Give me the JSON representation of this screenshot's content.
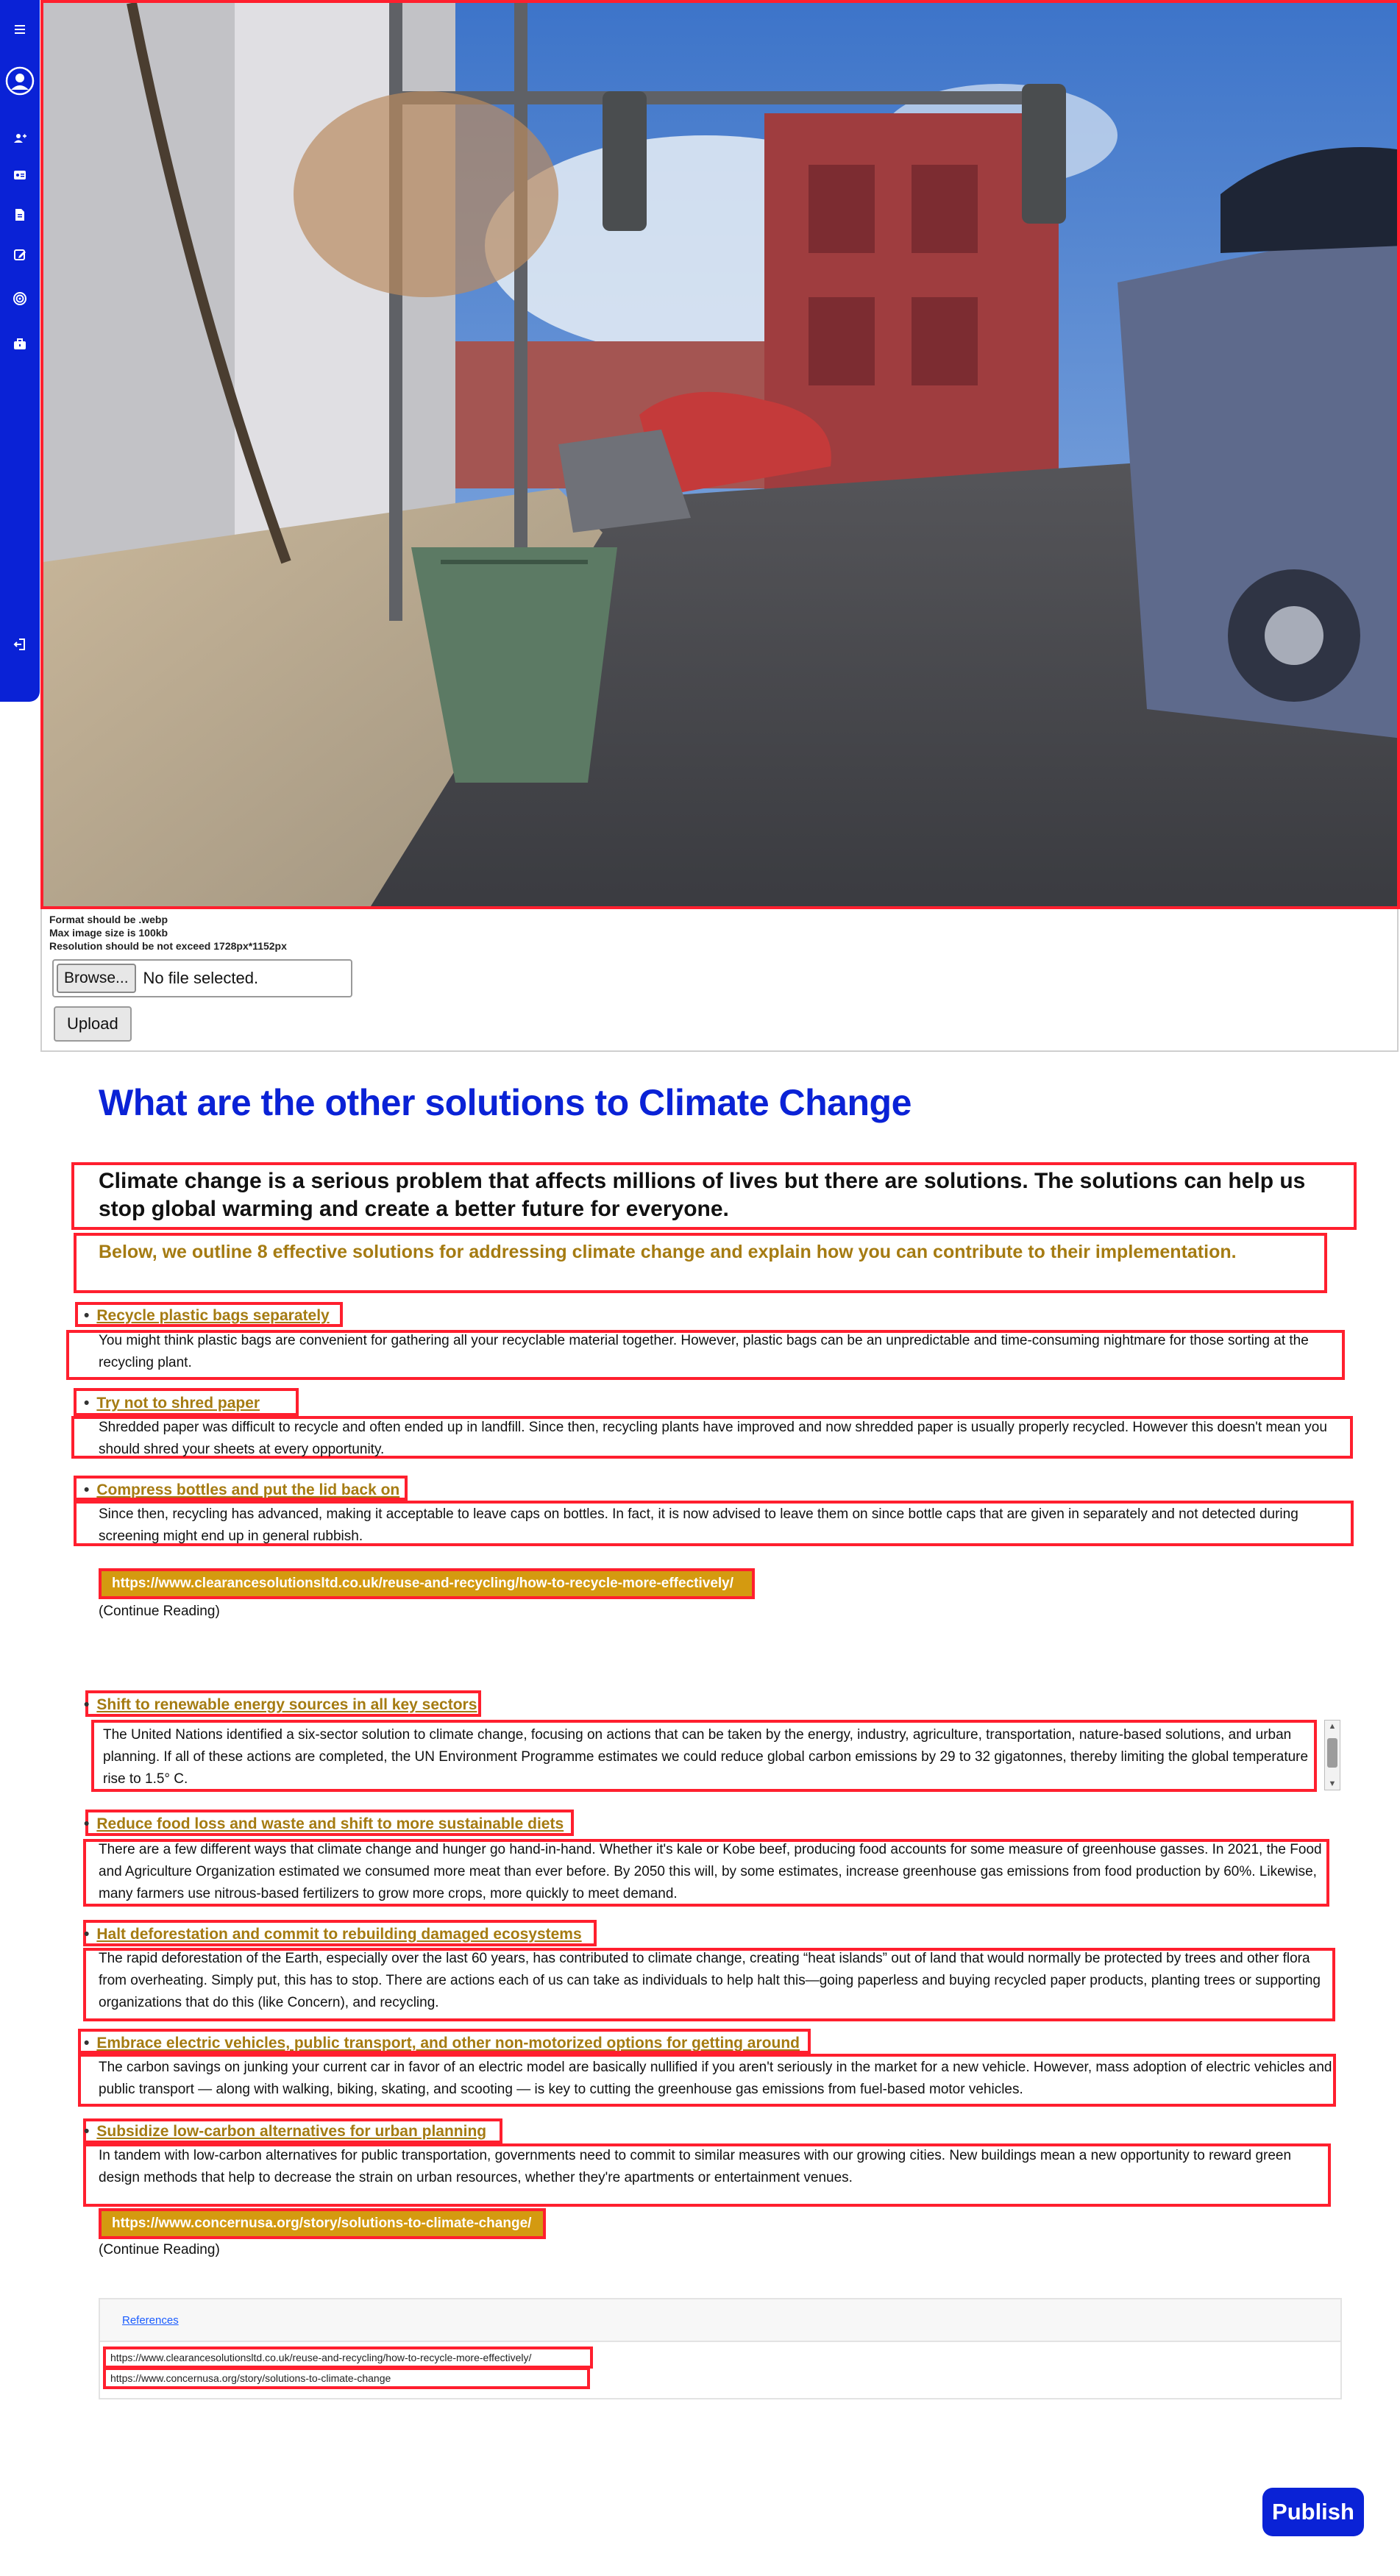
{
  "sidebar": {
    "items": [
      {
        "icon": "menu-icon"
      },
      {
        "icon": "user-avatar-icon"
      },
      {
        "icon": "add-user-icon"
      },
      {
        "icon": "id-card-icon"
      },
      {
        "icon": "document-icon"
      },
      {
        "icon": "edit-icon"
      },
      {
        "icon": "target-icon"
      },
      {
        "icon": "briefcase-icon"
      },
      {
        "icon": "logout-icon"
      }
    ],
    "color": "#0a22d6"
  },
  "upload": {
    "notes": [
      "Format should be .webp",
      "Max image size is 100kb",
      "Resolution should be not exceed 1728px*1152px"
    ],
    "browse_label": "Browse...",
    "file_status": "No file selected.",
    "upload_label": "Upload"
  },
  "article": {
    "title": "What are the other solutions to Climate Change",
    "intro": "Climate change is a serious problem that affects millions of lives but there are solutions. The solutions can help us stop global warming and create a better future for everyone.",
    "sub_intro": "Below, we outline 8 effective solutions for addressing climate change and explain how you can contribute to their implementation.",
    "sections": [
      {
        "heading": "Recycle plastic bags separately",
        "text": "You might think plastic bags are convenient for gathering all your recyclable material together. However, plastic bags can be an unpredictable and time-consuming nightmare for those sorting at the recycling plant."
      },
      {
        "heading": "Try not to shred paper",
        "text": "Shredded paper was difficult to recycle and often ended up in landfill. Since then, recycling plants have improved and now shredded paper is usually properly recycled. However this doesn't mean you should shred your sheets at every opportunity."
      },
      {
        "heading": "Compress bottles and put the lid back on",
        "text": "Since then, recycling has advanced, making it acceptable to leave caps on bottles. In fact, it is now advised to leave them on since bottle caps that are given in separately and not detected during screening might end up in general rubbish."
      },
      {
        "heading": "Shift to renewable energy sources in all key sectors",
        "text": "The United Nations identified a six-sector solution to climate change, focusing on actions that can be taken by the energy, industry, agriculture, transportation, nature-based solutions, and urban planning. If all of these actions are completed, the UN Environment Programme estimates we could reduce global carbon emissions by 29 to 32 gigatonnes, thereby limiting the global temperature rise to 1.5° C."
      },
      {
        "heading": "Reduce food loss and waste and shift to more sustainable diets",
        "text": "There are a few different ways that climate change and hunger go hand-in-hand. Whether it's kale or Kobe beef, producing food accounts for some measure of greenhouse gasses. In 2021, the Food and Agriculture Organization estimated we consumed more meat than ever before. By 2050 this will, by some estimates, increase greenhouse gas emissions from food production by 60%. Likewise, many farmers use nitrous-based fertilizers to grow more crops, more quickly to meet demand."
      },
      {
        "heading": "Halt deforestation and commit to rebuilding damaged ecosystems",
        "text": "The rapid deforestation of the Earth, especially over the last 60 years, has contributed to climate change, creating “heat islands” out of land that would normally be protected by trees and other flora from overheating. Simply put, this has to stop. There are actions each of us can take as individuals to help halt this—going paperless and buying recycled paper products, planting trees or supporting organizations that do this (like Concern), and recycling."
      },
      {
        "heading": "Embrace electric vehicles, public transport, and other non-motorized options for getting around",
        "text": "The carbon savings on junking your current car in favor of an electric model are basically nullified if you aren't seriously in the market for a new vehicle. However, mass adoption of electric vehicles and public transport — along with walking, biking, skating, and scooting — is key to cutting the greenhouse gas emissions from fuel-based motor vehicles."
      },
      {
        "heading": "Subsidize low-carbon alternatives for urban planning",
        "text": "In tandem with low-carbon alternatives for public transportation, governments need to commit to similar measures with our growing cities. New buildings mean a new opportunity to reward green design methods that help to decrease the strain on urban resources, whether they're apartments or entertainment venues."
      }
    ],
    "links": [
      {
        "url": "https://www.clearancesolutionsltd.co.uk/reuse-and-recycling/how-to-recycle-more-effectively/",
        "continue": "(Continue Reading)"
      },
      {
        "url": "https://www.concernusa.org/story/solutions-to-climate-change/",
        "continue": "(Continue Reading)"
      }
    ],
    "link_color": "#d49a10",
    "heading_color": "#a57b12"
  },
  "references": {
    "label": "References",
    "items": [
      "https://www.clearancesolutionsltd.co.uk/reuse-and-recycling/how-to-recycle-more-effectively/",
      "https://www.concernusa.org/story/solutions-to-climate-change"
    ]
  },
  "publish_label": "Publish",
  "accent_color": "#0a22d6",
  "highlight_color": "#ff1f2e"
}
